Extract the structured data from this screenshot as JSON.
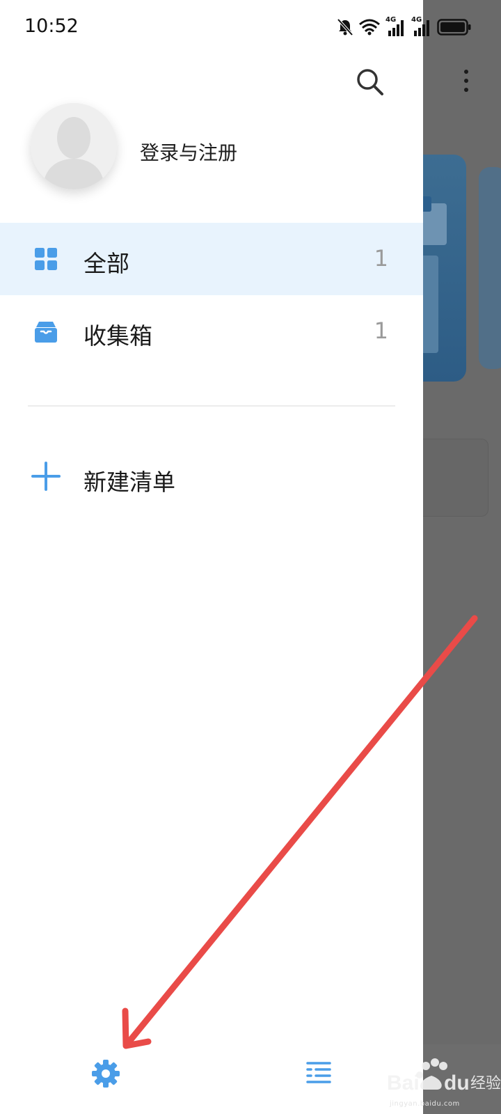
{
  "status_bar": {
    "time": "10:52",
    "network_1": "4G",
    "network_2": "4G"
  },
  "drawer": {
    "profile": {
      "login_label": "登录与注册"
    },
    "menu": [
      {
        "label": "全部",
        "count": "1",
        "icon": "grid-icon",
        "active": true
      },
      {
        "label": "收集箱",
        "count": "1",
        "icon": "inbox-icon",
        "active": false
      }
    ],
    "new_list_label": "新建清单"
  },
  "bottom_bar": {
    "settings_icon": "gear-icon",
    "list_icon": "list-icon"
  },
  "colors": {
    "accent": "#4a9de8",
    "active_bg": "#e8f3fd",
    "annotation_arrow": "#e94b48",
    "scrim": "#6a6a6a"
  },
  "watermark": {
    "text": "jingyan.baidu.com"
  }
}
